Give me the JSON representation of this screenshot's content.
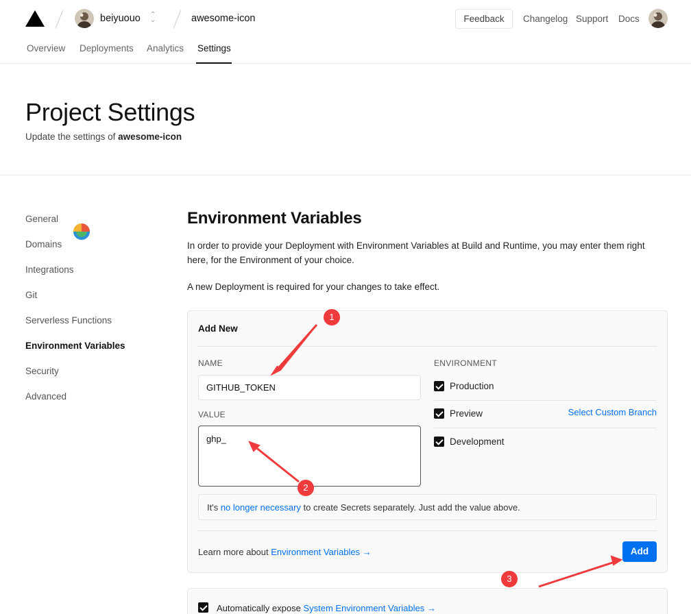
{
  "header": {
    "user_name": "beiyuouo",
    "project_name": "awesome-icon",
    "feedback_label": "Feedback",
    "links": [
      "Changelog",
      "Support",
      "Docs"
    ]
  },
  "tabs": [
    {
      "label": "Overview"
    },
    {
      "label": "Deployments"
    },
    {
      "label": "Analytics"
    },
    {
      "label": "Settings",
      "active": true
    }
  ],
  "hero": {
    "title": "Project Settings",
    "subtitle_prefix": "Update the settings of ",
    "subtitle_project": "awesome-icon"
  },
  "sidebar": {
    "items": [
      {
        "label": "General"
      },
      {
        "label": "Domains"
      },
      {
        "label": "Integrations"
      },
      {
        "label": "Git"
      },
      {
        "label": "Serverless Functions"
      },
      {
        "label": "Environment Variables",
        "active": true
      },
      {
        "label": "Security"
      },
      {
        "label": "Advanced"
      }
    ]
  },
  "main": {
    "title": "Environment Variables",
    "description": "In order to provide your Deployment with Environment Variables at Build and Runtime, you may enter them right here, for the Environment of your choice.",
    "note": "A new Deployment is required for your changes to take effect."
  },
  "add_new": {
    "title": "Add New",
    "name_label": "NAME",
    "name_value": "GITHUB_TOKEN",
    "value_label": "VALUE",
    "value_value": "ghp_",
    "environment_label": "ENVIRONMENT",
    "environments": [
      {
        "label": "Production",
        "checked": true
      },
      {
        "label": "Preview",
        "checked": true
      },
      {
        "label": "Development",
        "checked": true
      }
    ],
    "custom_branch_label": "Select Custom Branch",
    "notice_prefix": "It's ",
    "notice_link": "no longer necessary",
    "notice_suffix": " to create Secrets separately. Just add the value above.",
    "learn_more_prefix": "Learn more about ",
    "learn_more_link": "Environment Variables →",
    "add_button": "Add"
  },
  "system_vars": {
    "checked": true,
    "prefix": "Automatically expose ",
    "link": "System Environment Variables →"
  },
  "annotations": {
    "badges": [
      "1",
      "2",
      "3"
    ],
    "color": "#ef3b3b"
  },
  "colors": {
    "accent": "#0070f3",
    "text": "#111111",
    "border": "#e5e5e5"
  }
}
